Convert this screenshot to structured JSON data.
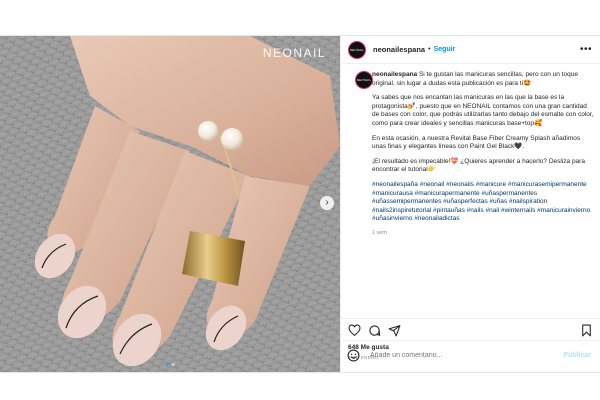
{
  "colors": {
    "link": "#0095f6",
    "hashtag": "#00376b",
    "text": "#262626",
    "muted": "#8e8e8e",
    "heart": "#e74c3c"
  },
  "media": {
    "watermark": "NEONAIL"
  },
  "header": {
    "username": "neonailespana",
    "separator": "•",
    "follow_label": "Seguir",
    "more_icon": "more-horizontal-icon",
    "avatar_text": "NEONAIL"
  },
  "caption": {
    "username": "neonailespana",
    "p1": "Si te gustan las manicuras sencillas, pero con un toque original, sin lugar a dudas esta publicación es para ti🤩",
    "p2": "Ya sabes que nos encantan las manicuras en las que la base es la protagonista💅, puesto que en NEONAIL contamos con una gran cantidad de bases con color, que podrás utilizarlas tanto debajo del esmalte con color, como para crear ideales y sencillas manicuras base+top🥰",
    "p3": "En esta ocasión, a nuestra Revital Base Fiber Creamy Splash añadimos unas finas y elegantes líneas con Paint Gel Black🖤.",
    "p4": "¡El resultado es impecable!💝 ¿Quieres aprender a hacerlo? Desliza para encontrar el tutorial👉",
    "hashtags": "#neonailespaña #neonail #neonails #manicure #manicurasemipermanente #manicurausa #manicurapermanente #uñaspermanentes #uñassemipermanentes #uñasperfectas #uñas #nailspiration #nails2inspiretutorial #pintauñas #nails #nail #winternails #manicurainvierno #uñasinvierno #neonailadictas",
    "time": "1 sem"
  },
  "actions": {
    "like_icon": "heart-icon",
    "comment_icon": "comment-icon",
    "share_icon": "share-icon",
    "save_icon": "bookmark-icon"
  },
  "likes": "648 Me gusta",
  "date": "4 DE ENERO",
  "comment": {
    "emoji_icon": "emoji-icon",
    "placeholder": "Añade un comentario...",
    "publish_label": "Publicar"
  }
}
